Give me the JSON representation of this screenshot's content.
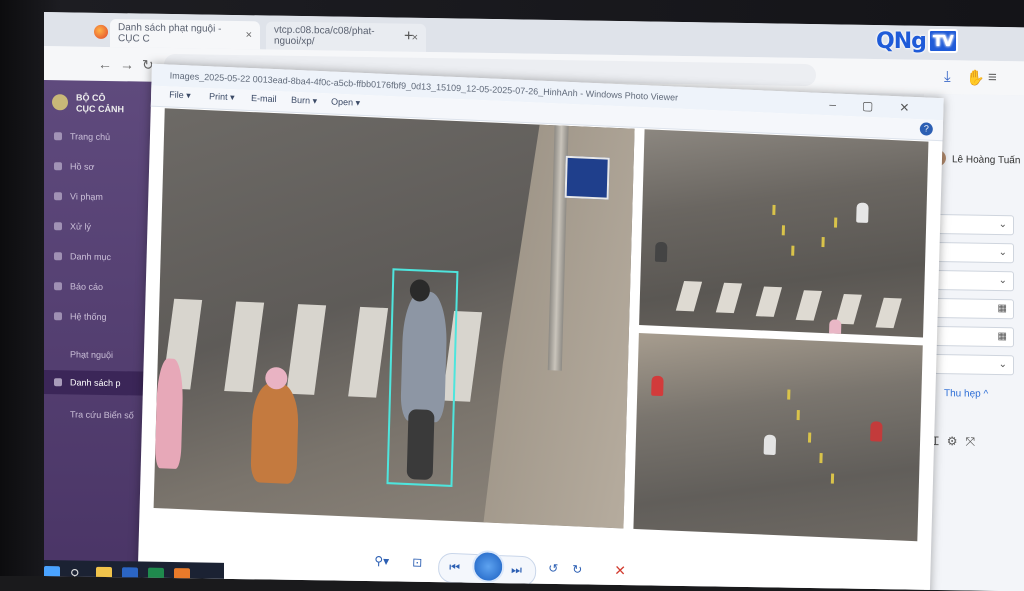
{
  "browser": {
    "tab1_title": "Danh sách phạt nguội - CỤC C",
    "tab2_url": "vtcp.c08.bca/c08/phat-nguoi/xp/",
    "tab_close": "×",
    "new_tab": "+"
  },
  "sidebar": {
    "header_line1": "BỘ CÔ",
    "header_line2": "CỤC CẢNH",
    "items": [
      {
        "label": "Trang chủ"
      },
      {
        "label": "Hồ sơ"
      },
      {
        "label": "Vi phạm"
      },
      {
        "label": "Xử lý"
      },
      {
        "label": "Danh mục"
      },
      {
        "label": "Báo cáo"
      },
      {
        "label": "Hệ thống"
      },
      {
        "label": "Phạt nguội"
      },
      {
        "label": "Danh sách p"
      },
      {
        "label": "Tra cứu Biển số"
      }
    ]
  },
  "viewer": {
    "title": "Images_2025-05-22 0013ead-8ba4-4f0c-a5cb-ffbb0176fbf9_0d13_15109_12-05-2025-07-26_HinhAnh - Windows Photo Viewer",
    "menu": {
      "file": "File ▾",
      "print": "Print ▾",
      "email": "E-mail",
      "burn": "Burn ▾",
      "open": "Open ▾"
    },
    "help": "?"
  },
  "right_panel": {
    "user_name": "Lê Hoàng Tuấn",
    "filter_label": "Thu hẹp ^"
  },
  "logo": {
    "text": "QNg",
    "tv": "TV"
  },
  "colors": {
    "accent": "#1f5bd8",
    "sidebar": "#4a3566",
    "detection_box": "#4ee5dd"
  }
}
